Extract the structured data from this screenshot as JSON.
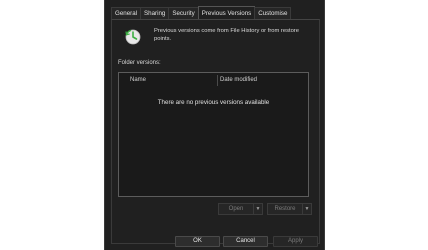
{
  "tabs": [
    {
      "label": "General",
      "active": false
    },
    {
      "label": "Sharing",
      "active": false
    },
    {
      "label": "Security",
      "active": false
    },
    {
      "label": "Previous Versions",
      "active": true
    },
    {
      "label": "Customise",
      "active": false
    }
  ],
  "info": {
    "icon": "previous-versions-icon",
    "text": "Previous versions come from File History or from restore points."
  },
  "versions": {
    "section_label": "Folder versions:",
    "columns": [
      "Name",
      "Date modified"
    ],
    "empty_message": "There are no previous versions available"
  },
  "actions": {
    "open_label": "Open",
    "restore_label": "Restore"
  },
  "footer": {
    "ok_label": "OK",
    "cancel_label": "Cancel",
    "apply_label": "Apply"
  },
  "colors": {
    "background": "#202020",
    "list_background": "#1a1a1a",
    "accent_green": "#3cb043"
  }
}
